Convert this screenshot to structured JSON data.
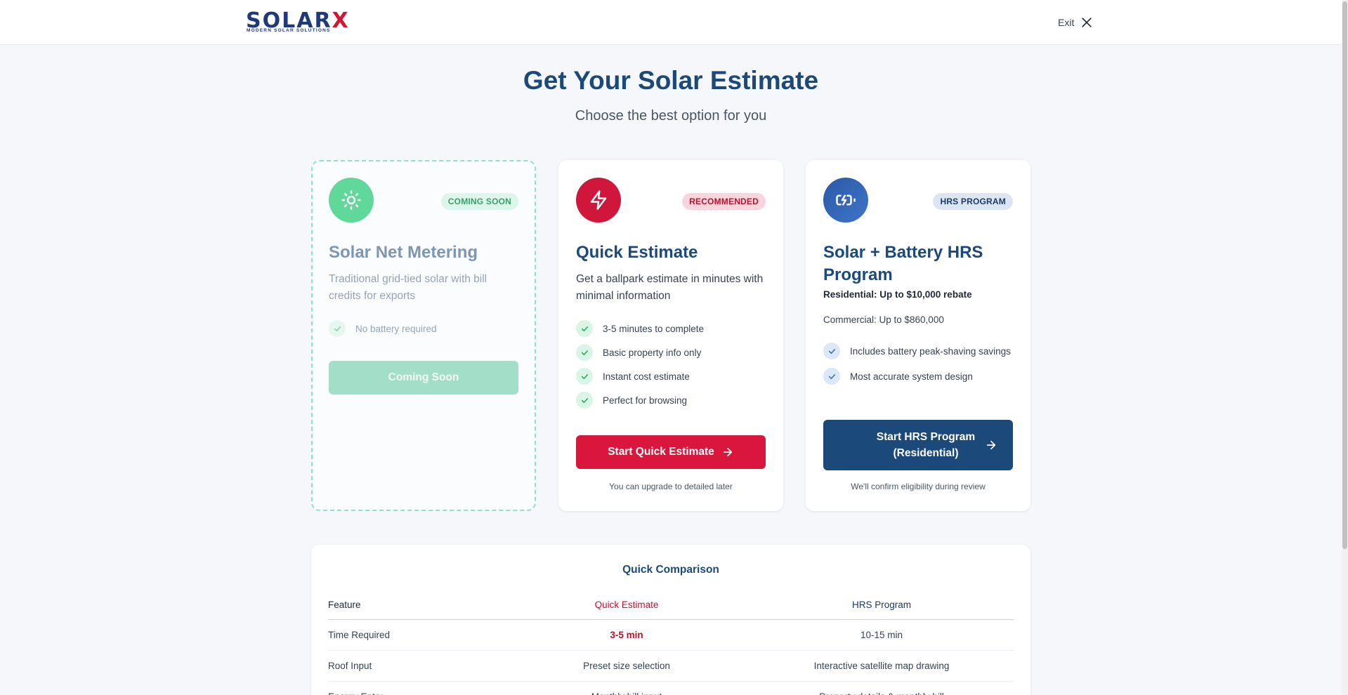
{
  "header": {
    "logo_word": "SOLAR",
    "logo_x": "X",
    "logo_tagline": "MODERN SOLAR SOLUTIONS",
    "exit_label": "Exit"
  },
  "page": {
    "title": "Get Your Solar Estimate",
    "subtitle": "Choose the best option for you"
  },
  "cards": [
    {
      "icon": "sun-icon",
      "badge": "COMING SOON",
      "title": "Solar Net Metering",
      "description": "Traditional grid-tied solar with bill credits for exports",
      "features": [
        "No battery required"
      ],
      "button": "Coming Soon"
    },
    {
      "icon": "lightning-icon",
      "badge": "RECOMMENDED",
      "title": "Quick Estimate",
      "description": "Get a ballpark estimate in minutes with minimal information",
      "features": [
        "3-5 minutes to complete",
        "Basic property info only",
        "Instant cost estimate",
        "Perfect for browsing"
      ],
      "button": "Start Quick Estimate",
      "note": "You can upgrade to detailed later"
    },
    {
      "icon": "battery-charging-icon",
      "badge": "HRS PROGRAM",
      "title": "Solar + Battery HRS Program",
      "residential": "Residential: Up to $10,000 rebate",
      "commercial": "Commercial: Up to $860,000",
      "features": [
        "Includes battery peak-shaving savings",
        "Most accurate system design"
      ],
      "button": "Start HRS Program (Residential)",
      "note": "We'll confirm eligibility during review"
    }
  ],
  "comparison": {
    "title": "Quick Comparison",
    "headers": [
      "Feature",
      "Quick Estimate",
      "HRS Program"
    ],
    "rows": [
      [
        "Time Required",
        "3-5 min",
        "10-15 min"
      ],
      [
        "Roof Input",
        "Preset size selection",
        "Interactive satellite map drawing"
      ],
      [
        "Energy Entry",
        "Monthly bill input",
        "Property details & monthly bill"
      ]
    ]
  },
  "colors": {
    "primary_navy": "#1b4a7a",
    "accent_red": "#d9173d",
    "green": "#5fd89a"
  }
}
